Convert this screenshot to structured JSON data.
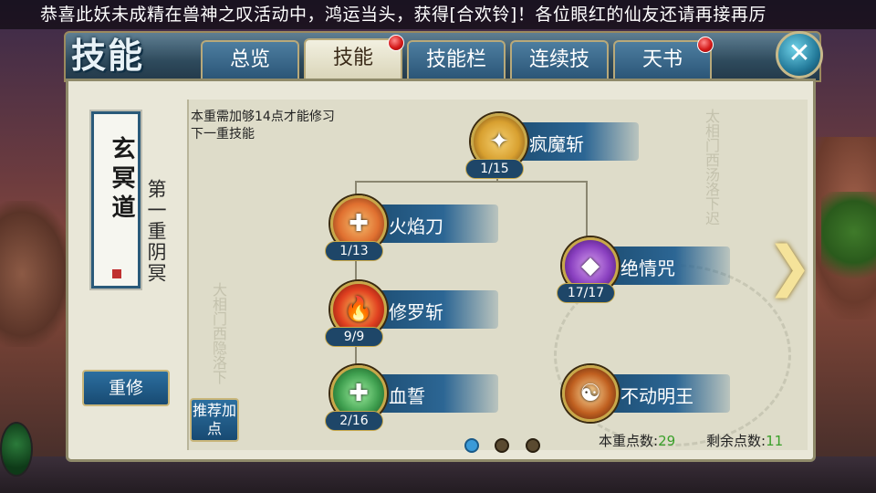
{
  "notice": "恭喜此妖未成精在兽神之叹活动中，鸿运当头，获得[合欢铃]！各位眼红的仙友还请再接再厉",
  "header": {
    "title": "技能",
    "tabs": [
      {
        "label": "总览",
        "badge": false
      },
      {
        "label": "技能",
        "badge": true,
        "active": true
      },
      {
        "label": "技能栏",
        "badge": false
      },
      {
        "label": "连续技",
        "badge": false
      },
      {
        "label": "天书",
        "badge": true
      }
    ],
    "close_icon": "close-icon"
  },
  "sidebar": {
    "scroll_text": "玄冥道",
    "tier_label": "第一重阴冥",
    "reset_label": "重修",
    "recommend_label": "推荐加点"
  },
  "hint": "本重需加够14点才能修习下一重技能",
  "skills": [
    {
      "name": "疯魔斩",
      "level": "1/15",
      "color": "#d8a030",
      "icon": "figure-burst-icon"
    },
    {
      "name": "火焰刀",
      "level": "1/13",
      "color": "#e07030",
      "icon": "figure-fire-icon"
    },
    {
      "name": "绝情咒",
      "level": "17/17",
      "color": "#8a40c0",
      "icon": "crystal-icon"
    },
    {
      "name": "修罗斩",
      "level": "9/9",
      "color": "#e04020",
      "icon": "flame-slash-icon"
    },
    {
      "name": "血誓",
      "level": "2/16",
      "color": "#40a050",
      "icon": "figure-green-icon"
    },
    {
      "name": "不动明王",
      "level": "",
      "color": "#c06020",
      "icon": "warrior-icon"
    }
  ],
  "pager": {
    "pages": 3,
    "current": 1
  },
  "stats": {
    "tier_points_label": "本重点数:",
    "tier_points": "29",
    "remaining_label": "剩余点数:",
    "remaining": "11"
  },
  "colors": {
    "accent_blue": "#2c6694",
    "gold": "#c8a84a",
    "panel": "#e9e7d8",
    "badge_red": "#d41a1a",
    "points_green": "#3aa02a"
  }
}
